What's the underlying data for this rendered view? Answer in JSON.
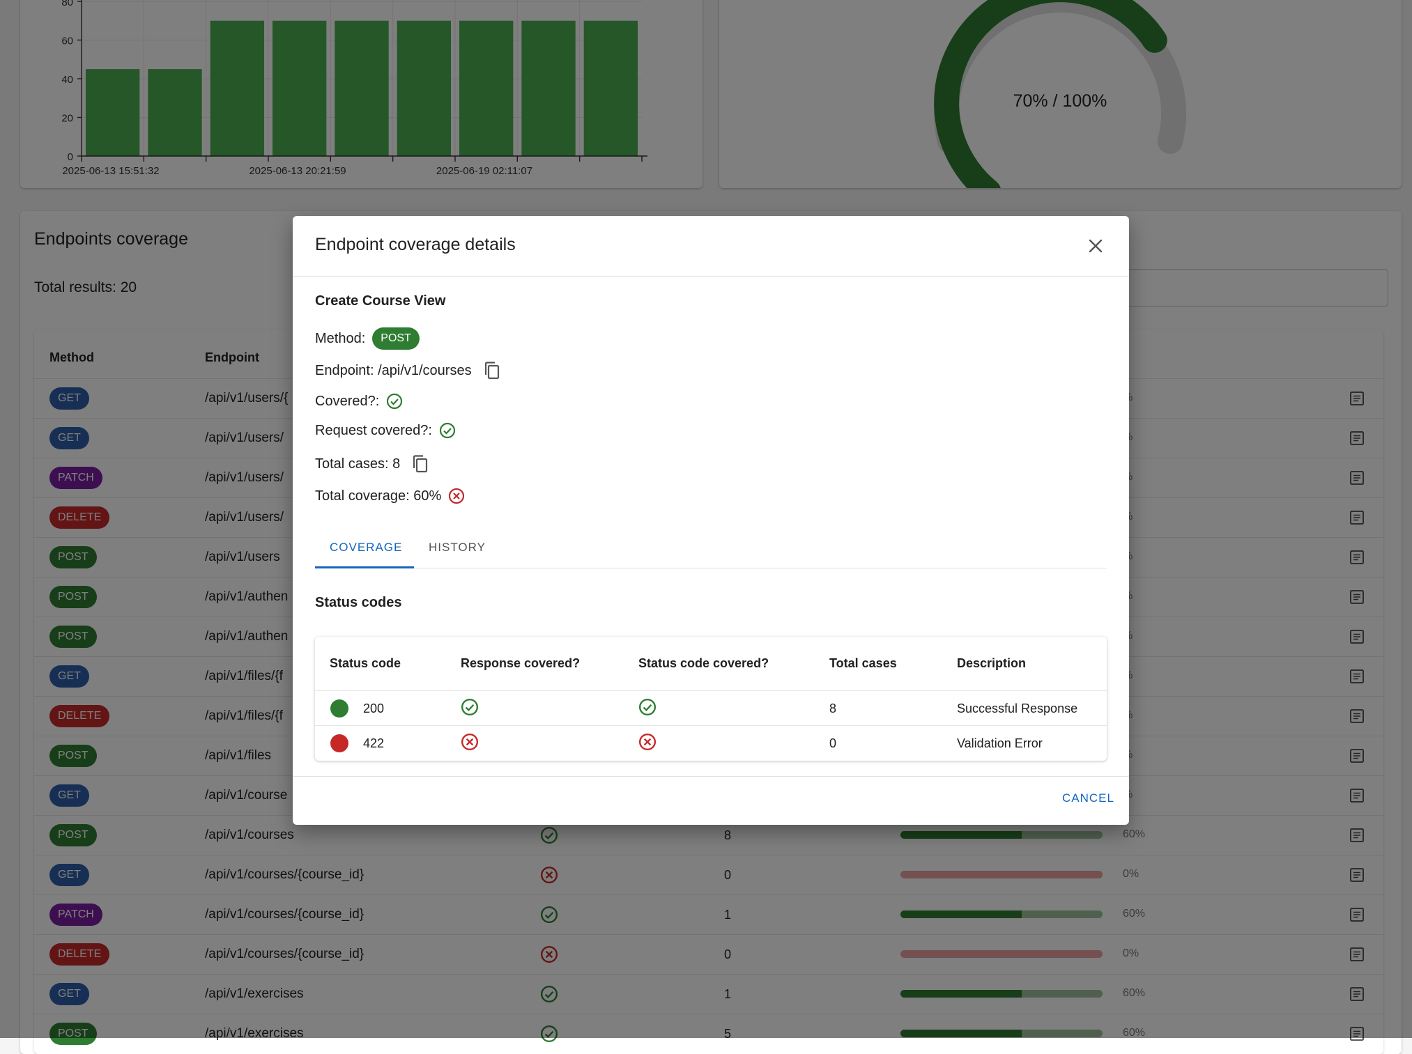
{
  "colors": {
    "get": "#2e5fa8",
    "post": "#2e7d32",
    "patch": "#7b1fa2",
    "delete": "#c62828",
    "bar": "#4caf50",
    "gauge_fill": "#2e7d32",
    "gauge_track": "#e0e0e0",
    "progress_fill": "#2e7d32",
    "progress_track": "#9fc09f",
    "progress_zero": "#e8a0a0",
    "accent": "#1565c0",
    "ok": "#2e7d32",
    "bad": "#c62828"
  },
  "chart_data": {
    "type": "bar",
    "categories": [
      "2025-06-13 15:51:32",
      "",
      "2025-06-13 20:21:59",
      "",
      "",
      "2025-06-19 02:11:07",
      "",
      "",
      ""
    ],
    "tick_labels": [
      "2025-06-13 15:51:32",
      "2025-06-13 20:21:59",
      "2025-06-19 02:11:07"
    ],
    "values": [
      45,
      45,
      70,
      70,
      70,
      70,
      70,
      70,
      70
    ],
    "y_ticks": [
      0,
      20,
      40,
      60,
      80
    ],
    "y_tick_labels": [
      "0",
      "20",
      "40",
      "60",
      "80"
    ],
    "ylim": [
      0,
      80
    ],
    "grid": true
  },
  "gauge": {
    "value": 70,
    "max": 100,
    "label": "70% / 100%"
  },
  "endpoints": {
    "title": "Endpoints coverage",
    "total_results": "Total results: 20",
    "headers": {
      "method": "Method",
      "endpoint": "Endpoint"
    },
    "rows": [
      {
        "method": "GET",
        "endpoint": "/api/v1/users/{",
        "covered": null,
        "cases": "",
        "coverage": null,
        "pct": "%"
      },
      {
        "method": "GET",
        "endpoint": "/api/v1/users/",
        "covered": null,
        "cases": "",
        "coverage": null,
        "pct": "%"
      },
      {
        "method": "PATCH",
        "endpoint": "/api/v1/users/",
        "covered": null,
        "cases": "",
        "coverage": null,
        "pct": "%"
      },
      {
        "method": "DELETE",
        "endpoint": "/api/v1/users/",
        "covered": null,
        "cases": "",
        "coverage": null,
        "pct": "%"
      },
      {
        "method": "POST",
        "endpoint": "/api/v1/users",
        "covered": null,
        "cases": "",
        "coverage": null,
        "pct": "%"
      },
      {
        "method": "POST",
        "endpoint": "/api/v1/authen",
        "covered": null,
        "cases": "",
        "coverage": null,
        "pct": "%"
      },
      {
        "method": "POST",
        "endpoint": "/api/v1/authen",
        "covered": null,
        "cases": "",
        "coverage": null,
        "pct": "%"
      },
      {
        "method": "GET",
        "endpoint": "/api/v1/files/{f",
        "covered": null,
        "cases": "",
        "coverage": null,
        "pct": "%"
      },
      {
        "method": "DELETE",
        "endpoint": "/api/v1/files/{f",
        "covered": null,
        "cases": "",
        "coverage": null,
        "pct": "%"
      },
      {
        "method": "POST",
        "endpoint": "/api/v1/files",
        "covered": null,
        "cases": "",
        "coverage": null,
        "pct": "%"
      },
      {
        "method": "GET",
        "endpoint": "/api/v1/course",
        "covered": null,
        "cases": "",
        "coverage": null,
        "pct": "%"
      },
      {
        "method": "POST",
        "endpoint": "/api/v1/courses",
        "covered": true,
        "cases": "8",
        "coverage": 60,
        "pct": "60%"
      },
      {
        "method": "GET",
        "endpoint": "/api/v1/courses/{course_id}",
        "covered": false,
        "cases": "0",
        "coverage": 0,
        "pct": "0%"
      },
      {
        "method": "PATCH",
        "endpoint": "/api/v1/courses/{course_id}",
        "covered": true,
        "cases": "1",
        "coverage": 60,
        "pct": "60%"
      },
      {
        "method": "DELETE",
        "endpoint": "/api/v1/courses/{course_id}",
        "covered": false,
        "cases": "0",
        "coverage": 0,
        "pct": "0%"
      },
      {
        "method": "GET",
        "endpoint": "/api/v1/exercises",
        "covered": true,
        "cases": "1",
        "coverage": 60,
        "pct": "60%"
      },
      {
        "method": "POST",
        "endpoint": "/api/v1/exercises",
        "covered": true,
        "cases": "5",
        "coverage": 60,
        "pct": "60%"
      }
    ]
  },
  "dialog": {
    "title": "Endpoint coverage details",
    "name": "Create Course View",
    "method_label": "Method:",
    "method": "POST",
    "endpoint_text": "Endpoint: /api/v1/courses",
    "covered_label": "Covered?:",
    "request_covered_label": "Request covered?:",
    "total_cases_text": "Total cases: 8",
    "total_coverage_text": "Total coverage: 60%",
    "tabs": [
      "COVERAGE",
      "HISTORY"
    ],
    "status_title": "Status codes",
    "status_headers": [
      "Status code",
      "Response covered?",
      "Status code covered?",
      "Total cases",
      "Description"
    ],
    "status_rows": [
      {
        "code": "200",
        "color": "#2e7d32",
        "response_covered": true,
        "status_covered": true,
        "cases": "8",
        "description": "Successful Response"
      },
      {
        "code": "422",
        "color": "#c62828",
        "response_covered": false,
        "status_covered": false,
        "cases": "0",
        "description": "Validation Error"
      }
    ],
    "cancel": "CANCEL"
  }
}
